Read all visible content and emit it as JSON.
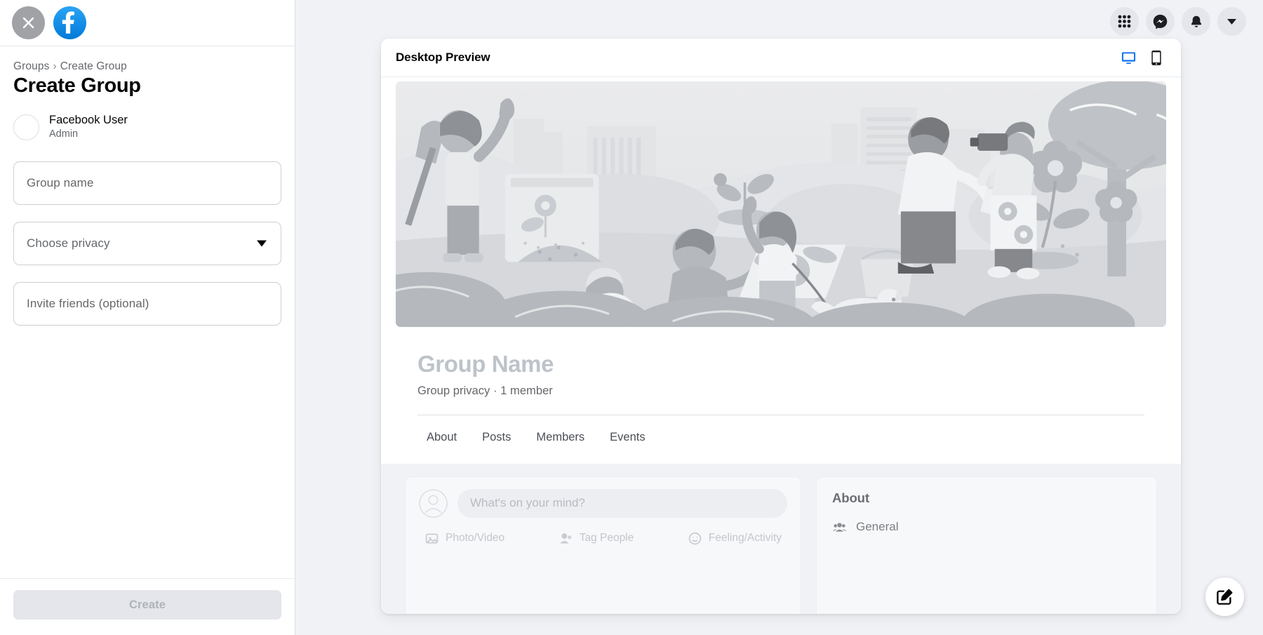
{
  "sidebar": {
    "close_icon": "close-icon",
    "logo_icon": "facebook-logo",
    "breadcrumb": {
      "root": "Groups",
      "separator": "›",
      "current": "Create Group"
    },
    "page_title": "Create Group",
    "user": {
      "name": "Facebook User",
      "role": "Admin",
      "avatar_icon": "avatar-placeholder"
    },
    "fields": {
      "group_name": {
        "label": "Group name",
        "value": ""
      },
      "privacy": {
        "label": "Choose privacy",
        "value": "",
        "caret_icon": "chevron-down-icon"
      },
      "invite": {
        "label": "Invite friends (optional)",
        "value": ""
      }
    },
    "create_button": {
      "label": "Create",
      "enabled": false
    }
  },
  "topnav": {
    "items": [
      {
        "name": "menu-grid-icon",
        "label": "Menu"
      },
      {
        "name": "messenger-icon",
        "label": "Messenger"
      },
      {
        "name": "bell-icon",
        "label": "Notifications"
      },
      {
        "name": "account-chevron-icon",
        "label": "Account"
      }
    ]
  },
  "preview": {
    "title": "Desktop Preview",
    "devices": [
      {
        "name": "desktop-icon",
        "label": "Desktop",
        "active": true,
        "color": "#1877f2"
      },
      {
        "name": "mobile-icon",
        "label": "Mobile",
        "active": false,
        "color": "#1c1e21"
      }
    ],
    "cover_alt": "community-garden-illustration",
    "group": {
      "name": "Group Name",
      "meta": "Group privacy · 1 member"
    },
    "tabs": [
      {
        "label": "About"
      },
      {
        "label": "Posts"
      },
      {
        "label": "Members"
      },
      {
        "label": "Events"
      }
    ],
    "composer": {
      "placeholder": "What's on your mind?",
      "avatar_icon": "avatar-placeholder",
      "actions": [
        {
          "label": "Photo/Video",
          "icon": "photo-video-icon"
        },
        {
          "label": "Tag People",
          "icon": "tag-people-icon"
        },
        {
          "label": "Feeling/Activity",
          "icon": "feeling-activity-icon"
        }
      ]
    },
    "about": {
      "title": "About",
      "items": [
        {
          "label": "General",
          "icon": "people-group-icon"
        }
      ]
    }
  },
  "fab": {
    "name": "compose-icon",
    "label": "Create post"
  },
  "colors": {
    "brand_blue": "#1877f2",
    "page_bg": "#f0f2f5",
    "card_bg": "#ffffff",
    "text_primary": "#050505",
    "text_secondary": "#65676b",
    "disabled_bg": "#e4e6eb",
    "disabled_text": "#b0b3b8"
  }
}
